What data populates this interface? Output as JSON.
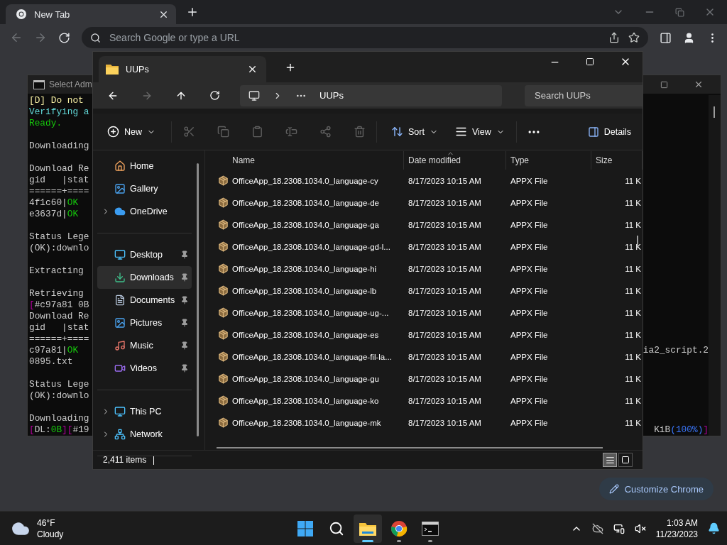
{
  "browser": {
    "tab": {
      "title": "New Tab"
    },
    "address": {
      "placeholder": "Search Google or type a URL"
    },
    "customize_button": "Customize Chrome"
  },
  "console": {
    "title": "Select Adm",
    "lines": [
      {
        "kind": "text",
        "left": [
          {
            "text": "[D] Do not",
            "color": "#f9f1a5"
          }
        ]
      },
      {
        "kind": "text",
        "left": [
          {
            "text": "Verifying a",
            "color": "#61d6d6"
          }
        ]
      },
      {
        "kind": "text",
        "left": [
          {
            "text": "Ready.",
            "color": "#16c60c"
          }
        ]
      },
      {
        "kind": "blank"
      },
      {
        "kind": "text",
        "left": [
          {
            "text": "Downloading"
          }
        ]
      },
      {
        "kind": "blank"
      },
      {
        "kind": "text",
        "left": [
          {
            "text": "Download Re"
          }
        ]
      },
      {
        "kind": "text",
        "left": [
          {
            "text": "gid   |stat"
          }
        ]
      },
      {
        "kind": "text",
        "left": [
          {
            "text": "======+===="
          }
        ]
      },
      {
        "kind": "text",
        "left": [
          {
            "text": "4f1c60|"
          },
          {
            "text": "OK",
            "color": "#16c60c"
          }
        ]
      },
      {
        "kind": "text",
        "left": [
          {
            "text": "e3637d|"
          },
          {
            "text": "OK",
            "color": "#16c60c"
          }
        ]
      },
      {
        "kind": "blank"
      },
      {
        "kind": "text",
        "left": [
          {
            "text": "Status Lege"
          }
        ]
      },
      {
        "kind": "text",
        "left": [
          {
            "text": "(OK):downlo"
          }
        ]
      },
      {
        "kind": "blank"
      },
      {
        "kind": "text",
        "left": [
          {
            "text": "Extracting"
          }
        ]
      },
      {
        "kind": "blank"
      },
      {
        "kind": "text",
        "left": [
          {
            "text": "Retrieving"
          }
        ]
      },
      {
        "kind": "text",
        "left": [
          {
            "text": "[",
            "color": "#b4009e"
          },
          {
            "text": "#c97a81 0B"
          }
        ]
      },
      {
        "kind": "text",
        "left": [
          {
            "text": "Download Re"
          }
        ]
      },
      {
        "kind": "text",
        "left": [
          {
            "text": "gid   |stat"
          }
        ]
      },
      {
        "kind": "text",
        "left": [
          {
            "text": "======+===="
          }
        ]
      },
      {
        "kind": "text",
        "left": [
          {
            "text": "c97a81|"
          },
          {
            "text": "OK",
            "color": "#16c60c"
          }
        ],
        "right": [
          {
            "text": "ia2_script.2"
          }
        ]
      },
      {
        "kind": "text",
        "left": [
          {
            "text": "0895.txt"
          }
        ]
      },
      {
        "kind": "blank"
      },
      {
        "kind": "text",
        "left": [
          {
            "text": "Status Lege"
          }
        ]
      },
      {
        "kind": "text",
        "left": [
          {
            "text": "(OK):downlo"
          }
        ]
      },
      {
        "kind": "blank"
      },
      {
        "kind": "text",
        "left": [
          {
            "text": "Downloading"
          }
        ]
      },
      {
        "kind": "text",
        "left": [
          {
            "text": "[",
            "color": "#b4009e"
          },
          {
            "text": "DL:"
          },
          {
            "text": "0B",
            "color": "#16c60c"
          },
          {
            "text": "][",
            "color": "#b4009e"
          },
          {
            "text": "#19"
          }
        ],
        "right": [
          {
            "text": "KiB"
          },
          {
            "text": "(100%)",
            "color": "#3b78ff"
          },
          {
            "text": "]",
            "color": "#b4009e"
          }
        ]
      }
    ]
  },
  "explorer": {
    "tab": {
      "title": "UUPs"
    },
    "breadcrumb": [
      "UUPs"
    ],
    "search": {
      "placeholder": "Search UUPs"
    },
    "toolbar": {
      "new": "New",
      "sort": "Sort",
      "view": "View",
      "details": "Details"
    },
    "sidebar": {
      "sections": [
        {
          "items": [
            {
              "label": "Home",
              "kind": "home",
              "expandable": false,
              "pinned": false,
              "selected": false
            },
            {
              "label": "Gallery",
              "kind": "gallery",
              "expandable": false,
              "pinned": false,
              "selected": false
            },
            {
              "label": "OneDrive",
              "kind": "cloud",
              "expandable": true,
              "pinned": false,
              "selected": false
            }
          ]
        },
        {
          "items": [
            {
              "label": "Desktop",
              "kind": "desktop",
              "expandable": false,
              "pinned": true,
              "selected": false
            },
            {
              "label": "Downloads",
              "kind": "downloads",
              "expandable": false,
              "pinned": true,
              "selected": true
            },
            {
              "label": "Documents",
              "kind": "documents",
              "expandable": false,
              "pinned": true,
              "selected": false
            },
            {
              "label": "Pictures",
              "kind": "pictures",
              "expandable": false,
              "pinned": true,
              "selected": false
            },
            {
              "label": "Music",
              "kind": "music",
              "expandable": false,
              "pinned": true,
              "selected": false
            },
            {
              "label": "Videos",
              "kind": "videos",
              "expandable": false,
              "pinned": true,
              "selected": false
            }
          ]
        },
        {
          "items": [
            {
              "label": "This PC",
              "kind": "pc",
              "expandable": true,
              "pinned": false,
              "selected": false
            },
            {
              "label": "Network",
              "kind": "network",
              "expandable": true,
              "pinned": false,
              "selected": false
            }
          ]
        }
      ]
    },
    "columns": [
      {
        "label": "Name",
        "sorted": false
      },
      {
        "label": "Date modified",
        "sorted": true
      },
      {
        "label": "Type",
        "sorted": false
      },
      {
        "label": "Size",
        "sorted": false
      }
    ],
    "rows": [
      {
        "name": "OfficeApp_18.2308.1034.0_language-cy",
        "date": "8/17/2023 10:15 AM",
        "type": "APPX File",
        "size": "11 K"
      },
      {
        "name": "OfficeApp_18.2308.1034.0_language-de",
        "date": "8/17/2023 10:15 AM",
        "type": "APPX File",
        "size": "11 K"
      },
      {
        "name": "OfficeApp_18.2308.1034.0_language-ga",
        "date": "8/17/2023 10:15 AM",
        "type": "APPX File",
        "size": "11 K"
      },
      {
        "name": "OfficeApp_18.2308.1034.0_language-gd-l...",
        "date": "8/17/2023 10:15 AM",
        "type": "APPX File",
        "size": "11 K"
      },
      {
        "name": "OfficeApp_18.2308.1034.0_language-hi",
        "date": "8/17/2023 10:15 AM",
        "type": "APPX File",
        "size": "11 K"
      },
      {
        "name": "OfficeApp_18.2308.1034.0_language-lb",
        "date": "8/17/2023 10:15 AM",
        "type": "APPX File",
        "size": "11 K"
      },
      {
        "name": "OfficeApp_18.2308.1034.0_language-ug-...",
        "date": "8/17/2023 10:15 AM",
        "type": "APPX File",
        "size": "11 K"
      },
      {
        "name": "OfficeApp_18.2308.1034.0_language-es",
        "date": "8/17/2023 10:15 AM",
        "type": "APPX File",
        "size": "11 K"
      },
      {
        "name": "OfficeApp_18.2308.1034.0_language-fil-la...",
        "date": "8/17/2023 10:15 AM",
        "type": "APPX File",
        "size": "11 K"
      },
      {
        "name": "OfficeApp_18.2308.1034.0_language-gu",
        "date": "8/17/2023 10:15 AM",
        "type": "APPX File",
        "size": "11 K"
      },
      {
        "name": "OfficeApp_18.2308.1034.0_language-ko",
        "date": "8/17/2023 10:15 AM",
        "type": "APPX File",
        "size": "11 K"
      },
      {
        "name": "OfficeApp_18.2308.1034.0_language-mk",
        "date": "8/17/2023 10:15 AM",
        "type": "APPX File",
        "size": "11 K"
      }
    ],
    "status": {
      "count": "2,411 items"
    },
    "view_buttons": [
      {
        "kind": "details",
        "selected": true
      },
      {
        "kind": "tiles",
        "selected": false
      }
    ]
  },
  "taskbar": {
    "weather": {
      "temperature": "46°F",
      "condition": "Cloudy"
    },
    "apps": [
      {
        "kind": "start",
        "active": false,
        "running": false
      },
      {
        "kind": "search",
        "active": false,
        "running": false
      },
      {
        "kind": "explorer",
        "active": true,
        "running": true
      },
      {
        "kind": "chrome",
        "active": false,
        "running": true
      },
      {
        "kind": "terminal",
        "active": false,
        "running": true
      }
    ],
    "clock": {
      "time": "1:03 AM",
      "date": "11/23/2023"
    }
  }
}
